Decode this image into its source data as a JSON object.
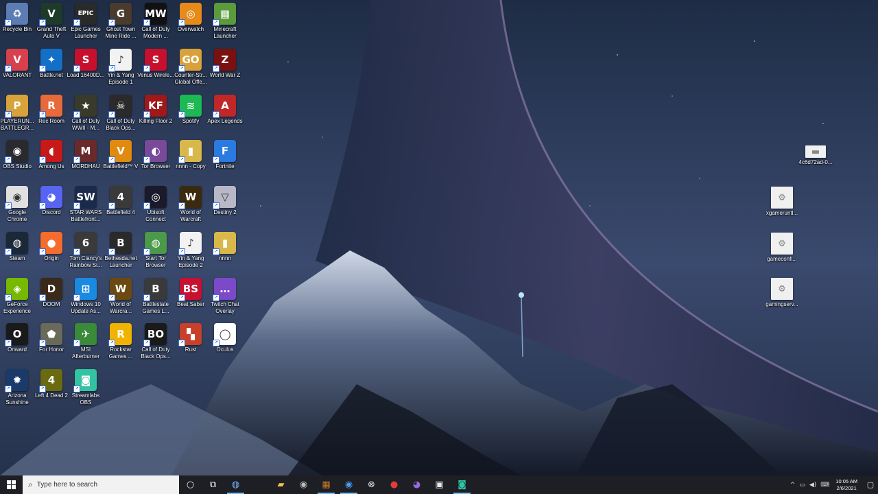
{
  "desktop": {
    "icons": [
      {
        "label": "Recycle Bin",
        "glyph": "♻",
        "bg": "#5b7db3"
      },
      {
        "label": "Grand Theft Auto V",
        "glyph": "V",
        "bg": "#1e3b2a"
      },
      {
        "label": "Epic Games Launcher",
        "glyph": "EPIC",
        "bg": "#2a2a2a"
      },
      {
        "label": "Ghost Town Mine Ride ...",
        "glyph": "G",
        "bg": "#4a3b2c"
      },
      {
        "label": "Call of Duty Modern ...",
        "glyph": "MW",
        "bg": "#111111"
      },
      {
        "label": "Overwatch",
        "glyph": "◎",
        "bg": "#e88a1a"
      },
      {
        "label": "Minecraft Launcher",
        "glyph": "▦",
        "bg": "#5c9b3c"
      },
      {
        "label": "VALORANT",
        "glyph": "V",
        "bg": "#d8404c"
      },
      {
        "label": "Battle.net",
        "glyph": "✦",
        "bg": "#1370c8"
      },
      {
        "label": "Load 16400D...",
        "glyph": "S",
        "bg": "#c8102e"
      },
      {
        "label": "Yin & Yang Episode 1",
        "glyph": "♪",
        "bg": "#f2f2f2"
      },
      {
        "label": "Venus Wirele...",
        "glyph": "S",
        "bg": "#c8102e"
      },
      {
        "label": "Counter-Str... Global Offe...",
        "glyph": "GO",
        "bg": "#d9a13a"
      },
      {
        "label": "World War Z",
        "glyph": "Z",
        "bg": "#7a1010"
      },
      {
        "label": "PLAYERUN... BATTLEGR...",
        "glyph": "P",
        "bg": "#d8a33a"
      },
      {
        "label": "Rec Room",
        "glyph": "R",
        "bg": "#e86a3a"
      },
      {
        "label": "Call of Duty WWII - M...",
        "glyph": "★",
        "bg": "#3a3a2a"
      },
      {
        "label": "Call of Duty Black Ops...",
        "glyph": "☠",
        "bg": "#2a2a2a"
      },
      {
        "label": "Killing Floor 2",
        "glyph": "KF",
        "bg": "#a01818"
      },
      {
        "label": "Spotify",
        "glyph": "≋",
        "bg": "#1db954"
      },
      {
        "label": "Apex Legends",
        "glyph": "A",
        "bg": "#c02828"
      },
      {
        "label": "OBS Studio",
        "glyph": "◉",
        "bg": "#2a2a2e"
      },
      {
        "label": "Among Us",
        "glyph": "◖",
        "bg": "#c81818"
      },
      {
        "label": "MORDHAU",
        "glyph": "M",
        "bg": "#6a2a2a"
      },
      {
        "label": "Battlefield™ V",
        "glyph": "V",
        "bg": "#e08a10"
      },
      {
        "label": "Tor Browser",
        "glyph": "◐",
        "bg": "#7a4a9a"
      },
      {
        "label": "nnnn - Copy",
        "glyph": "▮",
        "bg": "#d8b84a"
      },
      {
        "label": "Fortnite",
        "glyph": "F",
        "bg": "#2a7ae0"
      },
      {
        "label": "Google Chrome",
        "glyph": "◉",
        "bg": "#e0e0e0"
      },
      {
        "label": "Discord",
        "glyph": "◕",
        "bg": "#5865f2"
      },
      {
        "label": "STAR WARS Battlefront...",
        "glyph": "SW",
        "bg": "#1a2a4a"
      },
      {
        "label": "Battlefield 4",
        "glyph": "4",
        "bg": "#3a3a3a"
      },
      {
        "label": "Ubisoft Connect",
        "glyph": "◎",
        "bg": "#1a1a2a"
      },
      {
        "label": "World of Warcraft",
        "glyph": "W",
        "bg": "#3a2a10"
      },
      {
        "label": "Destiny 2",
        "glyph": "▽",
        "bg": "#b8b8c8"
      },
      {
        "label": "Steam",
        "glyph": "◍",
        "bg": "#1b2838"
      },
      {
        "label": "Origin",
        "glyph": "●",
        "bg": "#f56c2d"
      },
      {
        "label": "Tom Clancy's Rainbow Si...",
        "glyph": "6",
        "bg": "#3a3a3a"
      },
      {
        "label": "Bethesda.net Launcher",
        "glyph": "B",
        "bg": "#2a2a2a"
      },
      {
        "label": "Start Tor Browser",
        "glyph": "◍",
        "bg": "#4a9a4a"
      },
      {
        "label": "Yin & Yang Episode 2",
        "glyph": "♪",
        "bg": "#f2f2f2"
      },
      {
        "label": "nnnn",
        "glyph": "▮",
        "bg": "#d8b84a"
      },
      {
        "label": "GeForce Experience",
        "glyph": "◈",
        "bg": "#76b900"
      },
      {
        "label": "DOOM",
        "glyph": "D",
        "bg": "#3a2a1a"
      },
      {
        "label": "Windows 10 Update As...",
        "glyph": "⊞",
        "bg": "#1a8ae0"
      },
      {
        "label": "World of Warcra...",
        "glyph": "W",
        "bg": "#6a4a10"
      },
      {
        "label": "Battlestate Games L...",
        "glyph": "B",
        "bg": "#3a3a3a"
      },
      {
        "label": "Beat Saber",
        "glyph": "BS",
        "bg": "#c81030"
      },
      {
        "label": "Twitch Chat Overlay",
        "glyph": "…",
        "bg": "#7a4ac8"
      },
      {
        "label": "Onward",
        "glyph": "O",
        "bg": "#1a1a1a"
      },
      {
        "label": "For Honor",
        "glyph": "⬟",
        "bg": "#6a6a5a"
      },
      {
        "label": "MSI Afterburner",
        "glyph": "✈",
        "bg": "#3a8a3a"
      },
      {
        "label": "Rockstar Games ...",
        "glyph": "R",
        "bg": "#f0b400"
      },
      {
        "label": "Call of Duty Black Ops...",
        "glyph": "BO",
        "bg": "#1a1a1a"
      },
      {
        "label": "Rust",
        "glyph": "▚",
        "bg": "#c8402a"
      },
      {
        "label": "Oculus",
        "glyph": "◯",
        "bg": "#ffffff"
      },
      {
        "label": "Arizona Sunshine",
        "glyph": "✹",
        "bg": "#1a3a6a"
      },
      {
        "label": "Left 4 Dead 2",
        "glyph": "4",
        "bg": "#6a6a10"
      },
      {
        "label": "Streamlabs OBS",
        "glyph": "◙",
        "bg": "#31c3a2"
      }
    ],
    "right_icons": [
      {
        "label": "4c6d72ad-0...",
        "glyph": "▬",
        "bg": "#ffffff"
      },
      {
        "label": "xgameruntl...",
        "glyph": "⚙",
        "bg": "#f0f0f0"
      },
      {
        "label": "gameconfi...",
        "glyph": "⚙",
        "bg": "#f0f0f0"
      },
      {
        "label": "gamingserv...",
        "glyph": "⚙",
        "bg": "#f0f0f0"
      }
    ]
  },
  "taskbar": {
    "search_placeholder": "Type here to search",
    "apps": [
      {
        "name": "file-explorer",
        "glyph": "▰",
        "color": "#f2c24a"
      },
      {
        "name": "obs",
        "glyph": "◉",
        "color": "#bbbbbb"
      },
      {
        "name": "minecraft",
        "glyph": "▦",
        "color": "#c87a2a"
      },
      {
        "name": "chrome",
        "glyph": "◉",
        "color": "#4a9af0"
      },
      {
        "name": "xbox",
        "glyph": "⊗",
        "color": "#e8e8e8"
      },
      {
        "name": "recorder",
        "glyph": "●",
        "color": "#e83a3a"
      },
      {
        "name": "twitch-chat",
        "glyph": "◕",
        "color": "#9a6ae0"
      },
      {
        "name": "store",
        "glyph": "▣",
        "color": "#e8e8e8"
      },
      {
        "name": "streamlabs",
        "glyph": "◙",
        "color": "#31c3a2"
      }
    ],
    "time": "10:05 AM",
    "date": "2/6/2021"
  }
}
